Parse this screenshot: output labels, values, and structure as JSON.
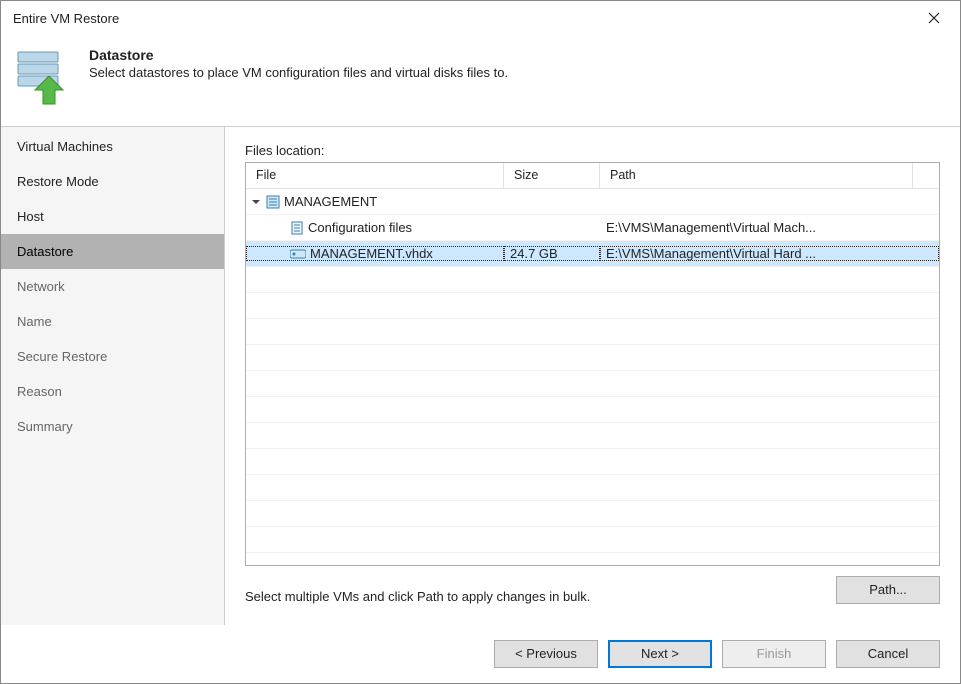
{
  "window": {
    "title": "Entire VM Restore"
  },
  "header": {
    "heading": "Datastore",
    "subheading": "Select datastores to place VM configuration files and virtual disks files to."
  },
  "sidebar": {
    "items": [
      {
        "label": "Virtual Machines",
        "state": "completed"
      },
      {
        "label": "Restore Mode",
        "state": "completed"
      },
      {
        "label": "Host",
        "state": "completed"
      },
      {
        "label": "Datastore",
        "state": "selected"
      },
      {
        "label": "Network",
        "state": "future"
      },
      {
        "label": "Name",
        "state": "future"
      },
      {
        "label": "Secure Restore",
        "state": "future"
      },
      {
        "label": "Reason",
        "state": "future"
      },
      {
        "label": "Summary",
        "state": "future"
      }
    ]
  },
  "main": {
    "files_location_label": "Files location:",
    "columns": {
      "file": "File",
      "size": "Size",
      "path": "Path"
    },
    "rows": [
      {
        "indent": 0,
        "type": "vm",
        "file": "MANAGEMENT",
        "size": "",
        "path": "",
        "expanded": true,
        "selected": false
      },
      {
        "indent": 1,
        "type": "cfg",
        "file": "Configuration files",
        "size": "",
        "path": "E:\\VMS\\Management\\Virtual Mach...",
        "expanded": false,
        "selected": false
      },
      {
        "indent": 1,
        "type": "disk",
        "file": "MANAGEMENT.vhdx",
        "size": "24.7 GB",
        "path": "E:\\VMS\\Management\\Virtual Hard ...",
        "expanded": false,
        "selected": true
      }
    ],
    "hint": "Select multiple VMs and click Path to apply changes in bulk.",
    "path_button": "Path..."
  },
  "footer": {
    "previous": "< Previous",
    "next": "Next >",
    "finish": "Finish",
    "cancel": "Cancel"
  }
}
